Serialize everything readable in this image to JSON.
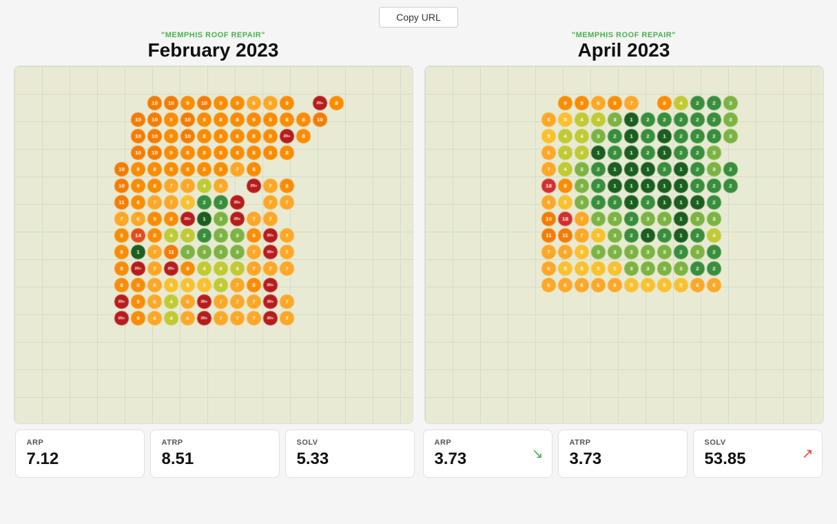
{
  "header": {
    "copy_url_label": "Copy URL"
  },
  "left_map": {
    "subtitle": "\"MEMPHIS ROOF REPAIR\"",
    "title": "February 2023",
    "stats": [
      {
        "label": "ARP",
        "value": "7.12",
        "arrow": null
      },
      {
        "label": "ATRP",
        "value": "8.51",
        "arrow": null
      },
      {
        "label": "SOLV",
        "value": "5.33",
        "arrow": null
      }
    ],
    "grid_cols": 16,
    "grid_rows": 18
  },
  "right_map": {
    "subtitle": "\"MEMPHIS ROOF REPAIR\"",
    "title": "April 2023",
    "stats": [
      {
        "label": "ARP",
        "value": "3.73",
        "arrow": "down"
      },
      {
        "label": "ATRP",
        "value": "3.73",
        "arrow": null
      },
      {
        "label": "SOLV",
        "value": "53.85",
        "arrow": "up"
      }
    ]
  },
  "colors": {
    "red": "#d32f2f",
    "dark_red": "#b71c1c",
    "orange_red": "#e64a19",
    "orange": "#f57c00",
    "yellow_orange": "#f9a825",
    "yellow": "#fbc02d",
    "yellow_green": "#afb42b",
    "light_green": "#7cb342",
    "green": "#388e3c",
    "dark_green": "#1b5e20"
  }
}
